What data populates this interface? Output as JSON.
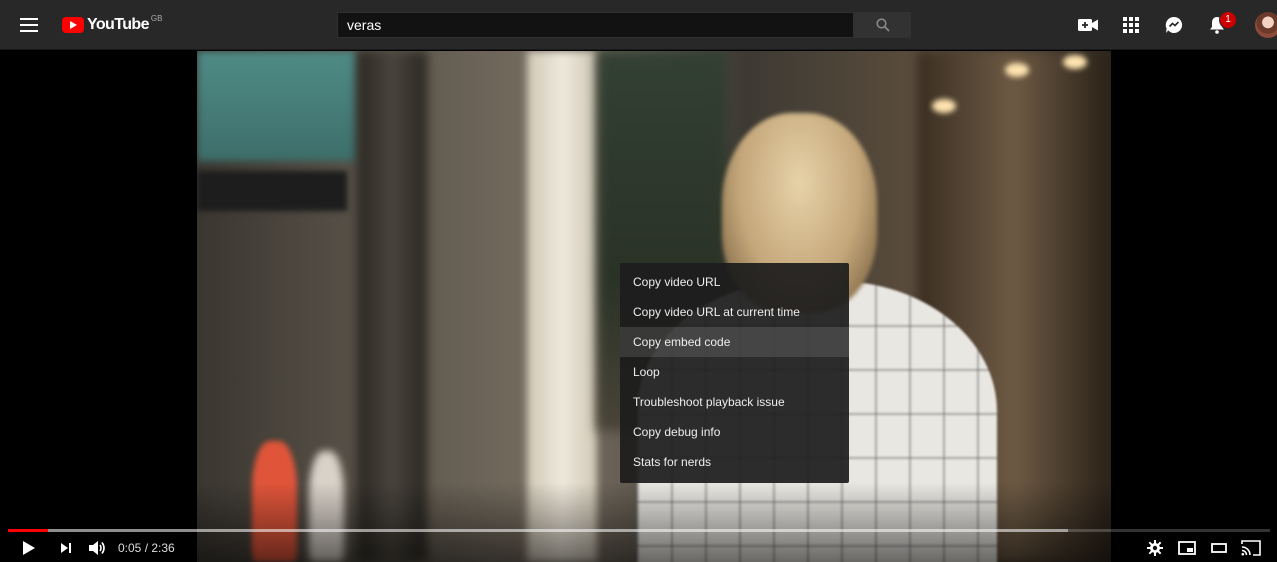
{
  "header": {
    "logo_text": "YouTube",
    "region": "GB",
    "search_value": "veras",
    "notifications_count": "1"
  },
  "icons": {
    "menu": "hamburger-icon",
    "search": "search-icon",
    "create": "video-camera-plus-icon",
    "apps": "apps-grid-icon",
    "messages": "messages-icon",
    "notifications": "bell-icon"
  },
  "context_menu": {
    "items": [
      {
        "label": "Copy video URL"
      },
      {
        "label": "Copy video URL at current time"
      },
      {
        "label": "Copy embed code",
        "highlighted": true
      },
      {
        "label": "Loop"
      },
      {
        "label": "Troubleshoot playback issue"
      },
      {
        "label": "Copy debug info"
      },
      {
        "label": "Stats for nerds"
      }
    ]
  },
  "player": {
    "current_time": "0:05",
    "duration": "2:36",
    "time_display": "0:05 / 2:36",
    "played_fraction": 0.032,
    "buffered_fraction": 0.84,
    "colors": {
      "progress": "#ff0000",
      "accent": "#cc0000"
    }
  }
}
